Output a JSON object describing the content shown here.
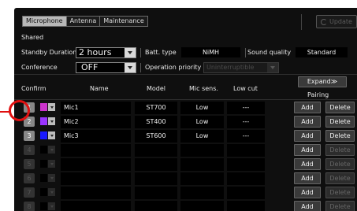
{
  "tabs": [
    {
      "label": "Microphone",
      "active": true
    },
    {
      "label": "Antenna",
      "active": false
    },
    {
      "label": "Maintenance",
      "active": false
    }
  ],
  "update": {
    "label": "Update",
    "icon": "refresh-icon",
    "enabled": false
  },
  "shared": {
    "title": "Shared",
    "standby_duration": {
      "label": "Standby Duration",
      "value": "2 hours"
    },
    "batt_type": {
      "label": "Batt. type",
      "value": "NiMH"
    },
    "sound_quality": {
      "label": "Sound quality",
      "value": "Standard"
    },
    "conference": {
      "label": "Conference",
      "value": "OFF"
    },
    "operation_priority": {
      "label": "Operation priority",
      "value": "Uninterruptible",
      "enabled": false
    }
  },
  "table": {
    "headers": {
      "confirm": "Confirm",
      "name": "Name",
      "model": "Model",
      "mic_sens": "Mic sens.",
      "low_cut": "Low cut",
      "pairing": "Pairing"
    },
    "expand_label": "Expand≫",
    "add_label": "Add",
    "delete_label": "Delete",
    "rows": [
      {
        "num": "1",
        "active": true,
        "color": "#cc33cc",
        "name": "Mic1",
        "model": "ST700",
        "sens": "Low",
        "lowcut": "---",
        "delete_enabled": true
      },
      {
        "num": "2",
        "active": true,
        "color": "#9933ff",
        "name": "Mic2",
        "model": "ST400",
        "sens": "Low",
        "lowcut": "---",
        "delete_enabled": true
      },
      {
        "num": "3",
        "active": true,
        "color": "#1a1aff",
        "name": "Mic3",
        "model": "ST600",
        "sens": "Low",
        "lowcut": "---",
        "delete_enabled": true
      },
      {
        "num": "4",
        "active": false,
        "color": "#000000",
        "name": "",
        "model": "",
        "sens": "",
        "lowcut": "",
        "delete_enabled": false
      },
      {
        "num": "5",
        "active": false,
        "color": "#000000",
        "name": "",
        "model": "",
        "sens": "",
        "lowcut": "",
        "delete_enabled": false
      },
      {
        "num": "6",
        "active": false,
        "color": "#000000",
        "name": "",
        "model": "",
        "sens": "",
        "lowcut": "",
        "delete_enabled": false
      },
      {
        "num": "7",
        "active": false,
        "color": "#000000",
        "name": "",
        "model": "",
        "sens": "",
        "lowcut": "",
        "delete_enabled": false
      },
      {
        "num": "8",
        "active": false,
        "color": "#000000",
        "name": "",
        "model": "",
        "sens": "",
        "lowcut": "",
        "delete_enabled": false
      }
    ]
  },
  "colors": {
    "panel_bg": "#0f0f0f",
    "callout": "#e01010",
    "active_tab": "#b8b8b8"
  }
}
